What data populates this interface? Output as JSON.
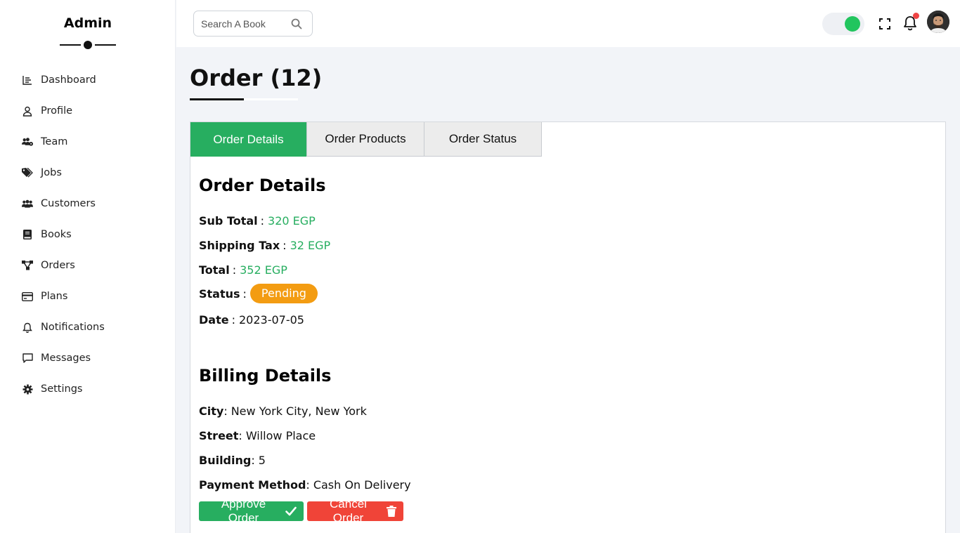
{
  "sidebar": {
    "brand": "Admin",
    "items": [
      {
        "label": "Dashboard",
        "icon": "chart-icon"
      },
      {
        "label": "Profile",
        "icon": "user-icon"
      },
      {
        "label": "Team",
        "icon": "team-icon"
      },
      {
        "label": "Jobs",
        "icon": "tags-icon"
      },
      {
        "label": "Customers",
        "icon": "users-icon"
      },
      {
        "label": "Books",
        "icon": "book-icon"
      },
      {
        "label": "Orders",
        "icon": "sitemap-icon"
      },
      {
        "label": "Plans",
        "icon": "credit-card-icon"
      },
      {
        "label": "Notifications",
        "icon": "bell-icon"
      },
      {
        "label": "Messages",
        "icon": "message-icon"
      },
      {
        "label": "Settings",
        "icon": "gear-icon"
      }
    ]
  },
  "topbar": {
    "search_placeholder": "Search A Book",
    "toggle_on": true,
    "has_notification": true
  },
  "page": {
    "title": "Order (12)"
  },
  "tabs": [
    "Order Details",
    "Order Products",
    "Order Status"
  ],
  "order_details": {
    "heading": "Order Details",
    "sub_total_label": "Sub Total",
    "sub_total": "320 EGP",
    "shipping_label": "Shipping Tax",
    "shipping": "32 EGP",
    "total_label": "Total",
    "total": "352 EGP",
    "status_label": "Status",
    "status": "Pending",
    "date_label": "Date",
    "date": "2023-07-05"
  },
  "billing": {
    "heading": "Billing Details",
    "city_label": "City",
    "city": "New York City, New York",
    "street_label": "Street",
    "street": "Willow Place",
    "building_label": "Building",
    "building": "5",
    "payment_label": "Payment Method",
    "payment": "Cash On Delivery"
  },
  "actions": {
    "approve": "Approve Order",
    "cancel": "Cancel Order"
  },
  "colors": {
    "accent_green": "#27ae60",
    "status_orange": "#f39c12",
    "danger_red": "#f04438",
    "toggle_green": "#22c55e"
  }
}
